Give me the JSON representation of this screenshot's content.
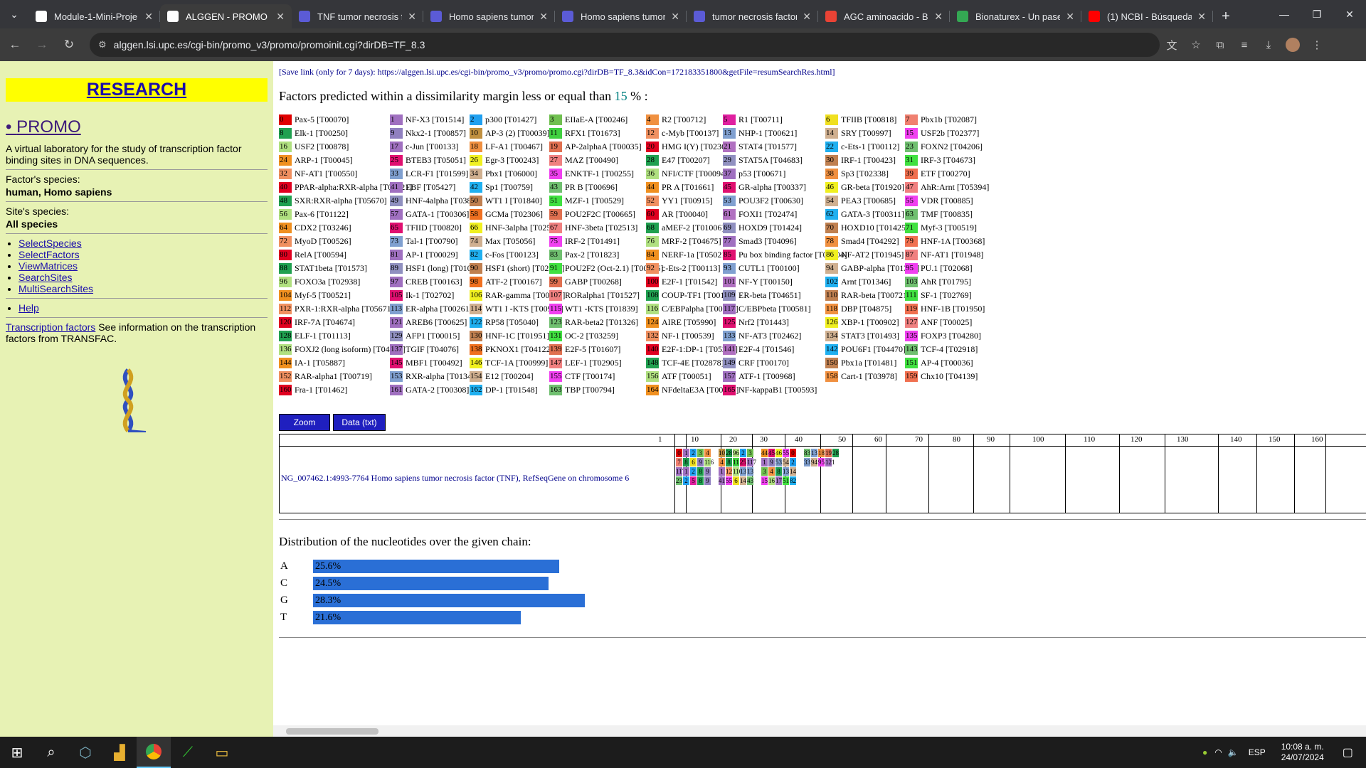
{
  "browser": {
    "tabs": [
      {
        "title": "Module-1-Mini-Proje",
        "color": "#ffffff"
      },
      {
        "title": "ALGGEN - PROMO",
        "color": "#ffffff",
        "active": true
      },
      {
        "title": "TNF tumor necrosis f",
        "color": "#5b5bd6"
      },
      {
        "title": "Homo sapiens tumor",
        "color": "#5b5bd6"
      },
      {
        "title": "Homo sapiens tumor",
        "color": "#5b5bd6"
      },
      {
        "title": "tumor necrosis factor",
        "color": "#5b5bd6"
      },
      {
        "title": "AGC aminoacido - Bu",
        "color": "#ea4335"
      },
      {
        "title": "Bionaturex - Un pase",
        "color": "#34a853"
      },
      {
        "title": "(1) NCBI - Búsqueda",
        "color": "#ff0000"
      }
    ],
    "url": "alggen.lsi.upc.es/cgi-bin/promo_v3/promo/promoinit.cgi?dirDB=TF_8.3"
  },
  "sidebar": {
    "research": "RESEARCH",
    "promo": "PROMO",
    "description": "A virtual laboratory for the study of transcription factor binding sites in DNA sequences.",
    "factor_species_label": "Factor's species:",
    "factor_species_value": "human, Homo sapiens",
    "site_species_label": "Site's species:",
    "site_species_value": "All species",
    "links": [
      "SelectSpecies",
      "SelectFactors",
      "ViewMatrices",
      "SearchSites",
      "MultiSearchSites"
    ],
    "help": "Help",
    "tf_link": "Transcription factors",
    "tf_text": " See information on the transcription factors from TRANSFAC."
  },
  "content": {
    "save_link": "[Save link (only for 7 days): https://alggen.lsi.upc.es/cgi-bin/promo_v3/promo/promo.cgi?dirDB=TF_8.3&idCon=172183351800&getFile=resumSearchRes.html]",
    "heading_pre": "Factors predicted within a dissimilarity margin less or equal than ",
    "heading_num": "15",
    "heading_post": " % :",
    "zoom": "Zoom",
    "data_txt": "Data (txt)",
    "sequence_name": "NG_007462.1:4993-7764 Homo sapiens tumor necrosis factor (TNF), RefSeqGene on chromosome 6",
    "ruler": [
      "1",
      "10",
      "20",
      "30",
      "40",
      "50",
      "60",
      "70",
      "80",
      "90",
      "100",
      "110",
      "120",
      "130",
      "140",
      "150",
      "160"
    ],
    "dist_title": "Distribution of the nucleotides over the given chain:",
    "distribution": [
      {
        "base": "A",
        "pct": "25.6%",
        "value": 25.6
      },
      {
        "base": "C",
        "pct": "24.5%",
        "value": 24.5
      },
      {
        "base": "G",
        "pct": "28.3%",
        "value": 28.3
      },
      {
        "base": "T",
        "pct": "21.6%",
        "value": 21.6
      }
    ]
  },
  "factors": [
    [
      "0",
      "Pax-5 [T00070]",
      "#e00000"
    ],
    [
      "1",
      "NF-X3 [T01514]",
      "#a070c0"
    ],
    [
      "2",
      "p300 [T01427]",
      "#20a0f0"
    ],
    [
      "3",
      "EIIaE-A [T00246]",
      "#70c050"
    ],
    [
      "4",
      "R2 [T00712]",
      "#f09040"
    ],
    [
      "5",
      "R1 [T00711]",
      "#e020a0"
    ],
    [
      "6",
      "TFIIB [T00818]",
      "#f0e020"
    ],
    [
      "7",
      "Pbx1b [T02087]",
      "#f08070"
    ],
    [
      "8",
      "Elk-1 [T00250]",
      "#20a050"
    ],
    [
      "9",
      "Nkx2-1 [T00857]",
      "#9080c0"
    ],
    [
      "10",
      "AP-3 (2) [T00039]",
      "#c09040"
    ],
    [
      "11",
      "RFX1 [T01673]",
      "#40d040"
    ],
    [
      "12",
      "c-Myb [T00137]",
      "#f09060"
    ],
    [
      "13",
      "NHP-1 [T00621]",
      "#80a0d0"
    ],
    [
      "14",
      "SRY [T00997]",
      "#d0b090"
    ],
    [
      "15",
      "USF2b [T02377]",
      "#f040f0"
    ],
    [
      "16",
      "USF2 [T00878]",
      "#b0e080"
    ],
    [
      "17",
      "c-Jun [T00133]",
      "#a070c0"
    ],
    [
      "18",
      "LF-A1 [T00467]",
      "#f09040"
    ],
    [
      "19",
      "AP-2alphaA [T00035]",
      "#e07050"
    ],
    [
      "20",
      "HMG I(Y) [T02368]",
      "#e00020"
    ],
    [
      "21",
      "STAT4 [T01577]",
      "#b070c0"
    ],
    [
      "22",
      "c-Ets-1 [T00112]",
      "#20b0f0"
    ],
    [
      "23",
      "FOXN2 [T04206]",
      "#70c070"
    ],
    [
      "24",
      "ARP-1 [T00045]",
      "#f09020"
    ],
    [
      "25",
      "BTEB3 [T05051]",
      "#e01070"
    ],
    [
      "26",
      "Egr-3 [T00243]",
      "#f0f020"
    ],
    [
      "27",
      "MAZ [T00490]",
      "#f08080"
    ],
    [
      "28",
      "E47 [T00207]",
      "#20a050"
    ],
    [
      "29",
      "STAT5A [T04683]",
      "#9090c0"
    ],
    [
      "30",
      "IRF-1 [T00423]",
      "#c08050"
    ],
    [
      "31",
      "IRF-3 [T04673]",
      "#40e040"
    ],
    [
      "32",
      "NF-AT1 [T00550]",
      "#f09060"
    ],
    [
      "33",
      "LCR-F1 [T01599]",
      "#80a0d0"
    ],
    [
      "34",
      "Pbx1 [T06000]",
      "#d0b090"
    ],
    [
      "35",
      "ENKTF-1 [T00255]",
      "#f040f0"
    ],
    [
      "36",
      "NFI/CTF [T00094]",
      "#b0e080"
    ],
    [
      "37",
      "p53 [T00671]",
      "#a070c0"
    ],
    [
      "38",
      "Sp3 [T02338]",
      "#f09040"
    ],
    [
      "39",
      "ETF [T00270]",
      "#f07050"
    ],
    [
      "40",
      "PPAR-alpha:RXR-alpha [T05221]",
      "#e00020"
    ],
    [
      "41",
      "EBF [T05427]",
      "#a070c0"
    ],
    [
      "42",
      "Sp1 [T00759]",
      "#20b0f0"
    ],
    [
      "43",
      "PR B [T00696]",
      "#70c070"
    ],
    [
      "44",
      "PR A [T01661]",
      "#f09020"
    ],
    [
      "45",
      "GR-alpha [T00337]",
      "#e01070"
    ],
    [
      "46",
      "GR-beta [T01920]",
      "#f0f020"
    ],
    [
      "47",
      "AhR:Arnt [T05394]",
      "#f08080"
    ],
    [
      "48",
      "SXR:RXR-alpha [T05670]",
      "#20a050"
    ],
    [
      "49",
      "HNF-4alpha [T03828]",
      "#9090c0"
    ],
    [
      "50",
      "WT1 I [T01840]",
      "#c08050"
    ],
    [
      "51",
      "MZF-1 [T00529]",
      "#40e040"
    ],
    [
      "52",
      "YY1 [T00915]",
      "#f09060"
    ],
    [
      "53",
      "POU3F2 [T00630]",
      "#80a0d0"
    ],
    [
      "54",
      "PEA3 [T00685]",
      "#d0b090"
    ],
    [
      "55",
      "VDR [T00885]",
      "#f040f0"
    ],
    [
      "56",
      "Pax-6 [T01122]",
      "#b0e080"
    ],
    [
      "57",
      "GATA-1 [T00306]",
      "#a070c0"
    ],
    [
      "58",
      "GCMa [T02306]",
      "#f07020"
    ],
    [
      "59",
      "POU2F2C [T00665]",
      "#e07050"
    ],
    [
      "60",
      "AR [T00040]",
      "#e00020"
    ],
    [
      "61",
      "FOXI1 [T02474]",
      "#b070c0"
    ],
    [
      "62",
      "GATA-3 [T00311]",
      "#20b0f0"
    ],
    [
      "63",
      "TMF [T00835]",
      "#70c070"
    ],
    [
      "64",
      "CDX2 [T03246]",
      "#f09020"
    ],
    [
      "65",
      "TFIID [T00820]",
      "#e01070"
    ],
    [
      "66",
      "HNF-3alpha [T02512]",
      "#f0f020"
    ],
    [
      "67",
      "HNF-3beta [T02513]",
      "#f08080"
    ],
    [
      "68",
      "aMEF-2 [T01006]",
      "#20a050"
    ],
    [
      "69",
      "HOXD9 [T01424]",
      "#9090c0"
    ],
    [
      "70",
      "HOXD10 [T01425]",
      "#c08050"
    ],
    [
      "71",
      "Myf-3 [T00519]",
      "#40e040"
    ],
    [
      "72",
      "MyoD [T00526]",
      "#f09060"
    ],
    [
      "73",
      "Tal-1 [T00790]",
      "#80a0d0"
    ],
    [
      "74",
      "Max [T05056]",
      "#d0b090"
    ],
    [
      "75",
      "IRF-2 [T01491]",
      "#f040f0"
    ],
    [
      "76",
      "MRF-2 [T04675]",
      "#b0e080"
    ],
    [
      "77",
      "Smad3 [T04096]",
      "#a070c0"
    ],
    [
      "78",
      "Smad4 [T04292]",
      "#f09040"
    ],
    [
      "79",
      "HNF-1A [T00368]",
      "#f07050"
    ],
    [
      "80",
      "RelA [T00594]",
      "#e00020"
    ],
    [
      "81",
      "AP-1 [T00029]",
      "#a070c0"
    ],
    [
      "82",
      "c-Fos [T00123]",
      "#20b0f0"
    ],
    [
      "83",
      "Pax-2 [T01823]",
      "#70c070"
    ],
    [
      "84",
      "NERF-1a [T05021]",
      "#f09020"
    ],
    [
      "85",
      "Pu box binding factor [T00704]",
      "#e01070"
    ],
    [
      "86",
      "NF-AT2 [T01945]",
      "#f0f020"
    ],
    [
      "87",
      "NF-AT1 [T01948]",
      "#f08080"
    ],
    [
      "88",
      "STAT1beta [T01573]",
      "#20a050"
    ],
    [
      "89",
      "HSF1 (long) [T01042]",
      "#9090c0"
    ],
    [
      "90",
      "HSF1 (short) [T02104]",
      "#c08050"
    ],
    [
      "91",
      "POU2F2 (Oct-2.1) [T00646]",
      "#40e040"
    ],
    [
      "92",
      "c-Ets-2 [T00113]",
      "#f09060"
    ],
    [
      "93",
      "CUTL1 [T00100]",
      "#80a0d0"
    ],
    [
      "94",
      "GABP-alpha [T01390]",
      "#d0b090"
    ],
    [
      "95",
      "PU.1 [T02068]",
      "#f040f0"
    ],
    [
      "96",
      "FOXO3a [T02938]",
      "#b0e080"
    ],
    [
      "97",
      "CREB [T00163]",
      "#a070c0"
    ],
    [
      "98",
      "ATF-2 [T00167]",
      "#f07020"
    ],
    [
      "99",
      "GABP [T00268]",
      "#e07050"
    ],
    [
      "100",
      "E2F-1 [T01542]",
      "#e00020"
    ],
    [
      "101",
      "NF-Y [T00150]",
      "#b070c0"
    ],
    [
      "102",
      "Arnt [T01346]",
      "#20b0f0"
    ],
    [
      "103",
      "AhR [T01795]",
      "#70c070"
    ],
    [
      "104",
      "Myf-5 [T00521]",
      "#f09020"
    ],
    [
      "105",
      "Ik-1 [T02702]",
      "#e01070"
    ],
    [
      "106",
      "RAR-gamma [T00720]",
      "#f0f020"
    ],
    [
      "107",
      "RORalpha1 [T01527]",
      "#f08080"
    ],
    [
      "108",
      "COUP-TF1 [T00149]",
      "#20a050"
    ],
    [
      "109",
      "ER-beta [T04651]",
      "#9090c0"
    ],
    [
      "110",
      "RAR-beta [T00721]",
      "#c08050"
    ],
    [
      "111",
      "SF-1 [T02769]",
      "#40e040"
    ],
    [
      "112",
      "PXR-1:RXR-alpha [T05671]",
      "#f09060"
    ],
    [
      "113",
      "ER-alpha [T00261]",
      "#80a0d0"
    ],
    [
      "114",
      "WT1 I -KTS [T00900]",
      "#d0b090"
    ],
    [
      "115",
      "WT1 -KTS [T01839]",
      "#f040f0"
    ],
    [
      "116",
      "C/EBPalpha [T00105]",
      "#b0e080"
    ],
    [
      "117",
      "C/EBPbeta [T00581]",
      "#a070c0"
    ],
    [
      "118",
      "DBP [T04875]",
      "#f09040"
    ],
    [
      "119",
      "HNF-1B [T01950]",
      "#f07050"
    ],
    [
      "120",
      "IRF-7A [T04674]",
      "#e00020"
    ],
    [
      "121",
      "AREB6 [T00625]",
      "#a070c0"
    ],
    [
      "122",
      "RP58 [T05040]",
      "#20b0f0"
    ],
    [
      "123",
      "RAR-beta2 [T01326]",
      "#70c070"
    ],
    [
      "124",
      "AIRE [T05990]",
      "#f09020"
    ],
    [
      "125",
      "Nrf2 [T01443]",
      "#e01070"
    ],
    [
      "126",
      "XBP-1 [T00902]",
      "#f0f020"
    ],
    [
      "127",
      "ANF [T00025]",
      "#f08080"
    ],
    [
      "128",
      "ELF-1 [T01113]",
      "#20a050"
    ],
    [
      "129",
      "AFP1 [T00015]",
      "#9090c0"
    ],
    [
      "130",
      "HNF-1C [T01951]",
      "#c08050"
    ],
    [
      "131",
      "OC-2 [T03259]",
      "#40e040"
    ],
    [
      "132",
      "NF-1 [T00539]",
      "#f09060"
    ],
    [
      "133",
      "NF-AT3 [T02462]",
      "#80a0d0"
    ],
    [
      "134",
      "STAT3 [T01493]",
      "#d0b090"
    ],
    [
      "135",
      "FOXP3 [T04280]",
      "#f040f0"
    ],
    [
      "136",
      "FOXJ2 (long isoform) [T04169]",
      "#b0e080"
    ],
    [
      "137",
      "TGIF [T04076]",
      "#a070c0"
    ],
    [
      "138",
      "PKNOX1 [T04122]",
      "#f07020"
    ],
    [
      "139",
      "E2F-5 [T01607]",
      "#e07050"
    ],
    [
      "140",
      "E2F-1:DP-1 [T05204]",
      "#e00020"
    ],
    [
      "141",
      "E2F-4 [T01546]",
      "#b070c0"
    ],
    [
      "142",
      "POU6F1 [T04470]",
      "#20b0f0"
    ],
    [
      "143",
      "TCF-4 [T02918]",
      "#70c070"
    ],
    [
      "144",
      "IA-1 [T05887]",
      "#f09020"
    ],
    [
      "145",
      "MBF1 [T00492]",
      "#e01070"
    ],
    [
      "146",
      "TCF-1A [T00999]",
      "#f0f020"
    ],
    [
      "147",
      "LEF-1 [T02905]",
      "#f08080"
    ],
    [
      "148",
      "TCF-4E [T02878]",
      "#20a050"
    ],
    [
      "149",
      "CRF [T00170]",
      "#9090c0"
    ],
    [
      "150",
      "Pbx1a [T01481]",
      "#c08050"
    ],
    [
      "151",
      "AP-4 [T00036]",
      "#40e040"
    ],
    [
      "152",
      "RAR-alpha1 [T00719]",
      "#f09060"
    ],
    [
      "153",
      "RXR-alpha [T01345]",
      "#80a0d0"
    ],
    [
      "154",
      "E12 [T00204]",
      "#d0b090"
    ],
    [
      "155",
      "CTF [T00174]",
      "#f040f0"
    ],
    [
      "156",
      "ATF [T00051]",
      "#b0e080"
    ],
    [
      "157",
      "ATF-1 [T00968]",
      "#a070c0"
    ],
    [
      "158",
      "Cart-1 [T03978]",
      "#f09040"
    ],
    [
      "159",
      "Chx10 [T04139]",
      "#f07050"
    ],
    [
      "160",
      "Fra-1 [T01462]",
      "#e00020"
    ],
    [
      "161",
      "GATA-2 [T00308]",
      "#a070c0"
    ],
    [
      "162",
      "DP-1 [T01548]",
      "#20b0f0"
    ],
    [
      "163",
      "TBP [T00794]",
      "#70c070"
    ],
    [
      "164",
      "NFdeltaE3A [T00976]",
      "#f09020"
    ],
    [
      "165",
      "NF-kappaB1 [T00593]",
      "#e01070"
    ]
  ],
  "sequence_boxes": [
    [
      "0",
      "#e00000"
    ],
    [
      "1",
      "#a070c0"
    ],
    [
      "2",
      "#20a0f0"
    ],
    [
      "3",
      "#70c050"
    ],
    [
      "4",
      "#f09040"
    ],
    [
      "7",
      "#f08070"
    ],
    [
      "8",
      "#20a050"
    ],
    [
      "6",
      "#f0e020"
    ],
    [
      "9",
      "#9080c0"
    ],
    [
      "116",
      "#b0e080"
    ],
    [
      "117",
      "#a070c0"
    ],
    [
      "1",
      "#a070c0"
    ],
    [
      "2",
      "#20a0f0"
    ],
    [
      "8",
      "#20a050"
    ],
    [
      "9",
      "#9080c0"
    ],
    [
      "23",
      "#70c070"
    ],
    [
      "2",
      "#20a0f0"
    ],
    [
      "5",
      "#e020a0"
    ],
    [
      "8",
      "#20a050"
    ],
    [
      "9",
      "#9080c0"
    ],
    [
      "10",
      "#c09040"
    ],
    [
      "28",
      "#20a050"
    ],
    [
      "96",
      "#b0e080"
    ],
    [
      "2",
      "#20a0f0"
    ],
    [
      "3",
      "#70c050"
    ],
    [
      "4",
      "#f09040"
    ],
    [
      "8",
      "#20a050"
    ],
    [
      "11",
      "#40d040"
    ],
    [
      "25",
      "#e01070"
    ],
    [
      "117",
      "#a070c0"
    ],
    [
      "1",
      "#a070c0"
    ],
    [
      "12",
      "#f09060"
    ],
    [
      "116",
      "#b0e080"
    ],
    [
      "13",
      "#80a0d0"
    ],
    [
      "13",
      "#80a0d0"
    ],
    [
      "41",
      "#a070c0"
    ],
    [
      "55",
      "#f040f0"
    ],
    [
      "6",
      "#f0e020"
    ],
    [
      "14",
      "#d0b090"
    ],
    [
      "43",
      "#70c070"
    ],
    [
      "44",
      "#f09020"
    ],
    [
      "45",
      "#e01070"
    ],
    [
      "46",
      "#f0f020"
    ],
    [
      "55",
      "#f040f0"
    ],
    [
      "0",
      "#e00000"
    ],
    [
      "1",
      "#a070c0"
    ],
    [
      "9",
      "#9080c0"
    ],
    [
      "53",
      "#80a0d0"
    ],
    [
      "54",
      "#d0b090"
    ],
    [
      "2",
      "#20a0f0"
    ],
    [
      "3",
      "#70c050"
    ],
    [
      "4",
      "#f09040"
    ],
    [
      "8",
      "#20a050"
    ],
    [
      "13",
      "#80a0d0"
    ],
    [
      "14",
      "#d0b090"
    ],
    [
      "15",
      "#f040f0"
    ],
    [
      "16",
      "#b0e080"
    ],
    [
      "17",
      "#a070c0"
    ],
    [
      "51",
      "#40e040"
    ],
    [
      "82",
      "#20b0f0"
    ],
    [
      "83",
      "#70c070"
    ],
    [
      "13",
      "#80a0d0"
    ],
    [
      "18",
      "#f09040"
    ],
    [
      "19",
      "#e07050"
    ],
    [
      "28",
      "#20a050"
    ],
    [
      "33",
      "#80a0d0"
    ],
    [
      "94",
      "#d0b090"
    ],
    [
      "95",
      "#f040f0"
    ],
    [
      "121",
      "#a070c0"
    ]
  ],
  "taskbar": {
    "lang": "ESP",
    "time": "10:08 a. m.",
    "date": "24/07/2024"
  }
}
